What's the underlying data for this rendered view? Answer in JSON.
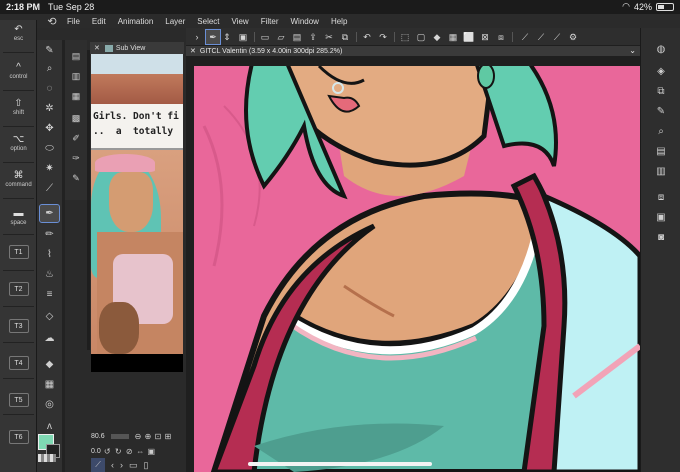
{
  "status": {
    "time": "2:18 PM",
    "date": "Tue Sep 28",
    "battery": "42%",
    "battery_level": 0.42
  },
  "menu": {
    "items": [
      "File",
      "Edit",
      "Animation",
      "Layer",
      "Select",
      "View",
      "Filter",
      "Window",
      "Help"
    ]
  },
  "shortcuts": {
    "esc": "esc",
    "control": "control",
    "shift": "shift",
    "option": "option",
    "command": "command",
    "space": "space",
    "t1": "T1",
    "t2": "T2",
    "t3": "T3",
    "t4": "T4",
    "t5": "T5",
    "t6": "T6"
  },
  "subview": {
    "title": "Sub View",
    "caption_line1": "Girls. Don't fi",
    "caption_line2": "..  a  totally",
    "zoom": "80.6",
    "rotation": "0.0"
  },
  "canvas": {
    "tab_title": "GITCL Valentin (3.59 x 4.00in 300dpi 285.2%)"
  },
  "colors": {
    "main": "#7fd9b3",
    "background": "#222222",
    "canvas_bg": "#e9679a",
    "skin": "#e0a57b",
    "hair": "#63cdb0",
    "top": "#5ebaa8",
    "strap": "#b52d52",
    "jacket": "#bff1f4",
    "accent": "#6a8fd6"
  }
}
